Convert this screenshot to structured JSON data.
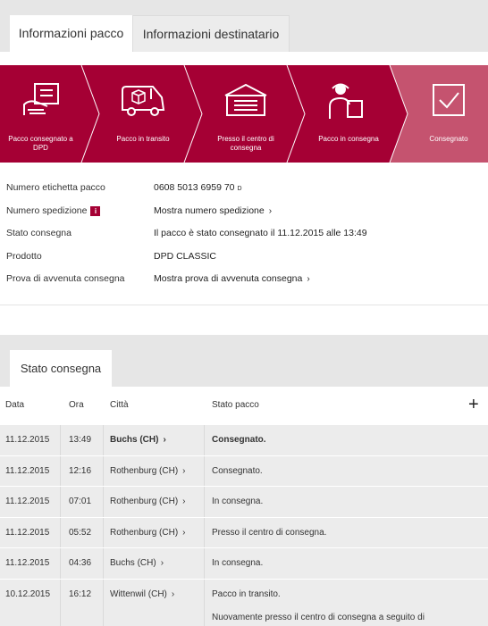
{
  "tabs": {
    "active": "Informazioni pacco",
    "inactive": "Informazioni destinatario"
  },
  "colors": {
    "brand": "#a50034",
    "brand_light": "#c5536f"
  },
  "steps": [
    {
      "label": "Pacco consegnato a DPD",
      "icon": "hand-with-parcel-icon"
    },
    {
      "label": "Pacco in transito",
      "icon": "delivery-van-icon"
    },
    {
      "label": "Presso il centro di consegna",
      "icon": "depot-garage-icon"
    },
    {
      "label": "Pacco in consegna",
      "icon": "courier-with-parcel-icon"
    },
    {
      "label": "Consegnato",
      "icon": "checkmark-icon"
    }
  ],
  "details": {
    "label_parcel_number": "Numero etichetta pacco",
    "value_parcel_number": "0608 5013 6959 70",
    "value_parcel_suffix": "D",
    "label_shipment_number": "Numero spedizione",
    "value_shipment_number": "Mostra numero spedizione",
    "label_status": "Stato consegna",
    "value_status": "Il pacco è stato consegnato il 11.12.2015 alle 13:49",
    "label_product": "Prodotto",
    "value_product": "DPD CLASSIC",
    "label_proof": "Prova di avvenuta consegna",
    "value_proof": "Mostra prova di avvenuta consegna"
  },
  "history": {
    "section_title": "Stato consegna",
    "columns": [
      "Data",
      "Ora",
      "Città",
      "Stato pacco"
    ],
    "rows": [
      {
        "date": "11.12.2015",
        "time": "13:49",
        "city": "Buchs (CH)",
        "status": "Consegnato."
      },
      {
        "date": "11.12.2015",
        "time": "12:16",
        "city": "Rothenburg (CH)",
        "status": "Consegnato."
      },
      {
        "date": "11.12.2015",
        "time": "07:01",
        "city": "Rothenburg (CH)",
        "status": "In consegna."
      },
      {
        "date": "11.12.2015",
        "time": "05:52",
        "city": "Rothenburg (CH)",
        "status": "Presso il centro di consegna."
      },
      {
        "date": "11.12.2015",
        "time": "04:36",
        "city": "Buchs (CH)",
        "status": "In consegna."
      },
      {
        "date": "10.12.2015",
        "time": "16:12",
        "city": "Wittenwil (CH)",
        "status": "Pacco in transito.",
        "extra": "Nuovamente presso il centro di consegna a seguito di"
      }
    ]
  }
}
